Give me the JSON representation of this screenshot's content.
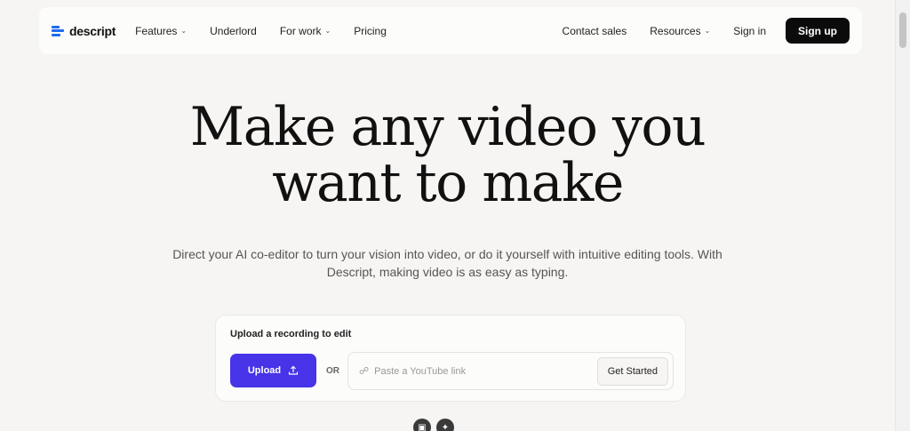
{
  "brand": {
    "name": "descript",
    "accent": "#1e6cf0"
  },
  "nav": {
    "left_items": [
      {
        "label": "Features",
        "has_dropdown": true
      },
      {
        "label": "Underlord",
        "has_dropdown": false
      },
      {
        "label": "For work",
        "has_dropdown": true
      },
      {
        "label": "Pricing",
        "has_dropdown": false
      }
    ],
    "right_items": [
      {
        "label": "Contact sales",
        "has_dropdown": false
      },
      {
        "label": "Resources",
        "has_dropdown": true
      },
      {
        "label": "Sign in",
        "has_dropdown": false
      }
    ],
    "signup_label": "Sign up"
  },
  "hero": {
    "title_line1": "Make any video you",
    "title_line2": "want to make",
    "subtitle": "Direct your AI co-editor to turn your vision into video, or do it yourself with intuitive editing tools. With Descript, making video is as easy as typing."
  },
  "upload": {
    "label": "Upload a recording to edit",
    "button_label": "Upload",
    "or_text": "OR",
    "youtube_placeholder": "Paste a YouTube link",
    "youtube_value": "",
    "get_started_label": "Get Started",
    "button_color": "#4733e8"
  },
  "icons": {
    "logo": "descript-logo-icon",
    "dropdown": "chevron-down-icon",
    "upload": "upload-icon",
    "link": "link-icon"
  }
}
